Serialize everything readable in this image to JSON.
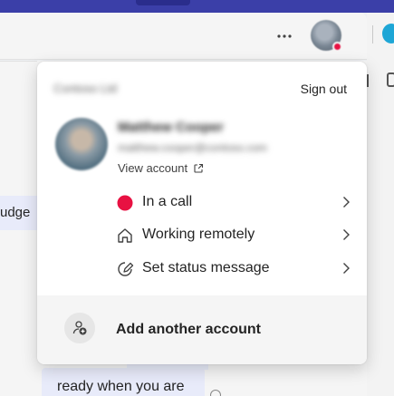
{
  "header": {
    "more_icon": "ellipsis-icon",
    "avatar_status_color": "#e81142"
  },
  "chat": {
    "partial_message": "udge",
    "message": "ready when you are"
  },
  "account_menu": {
    "org_name": "Contoso Ltd",
    "sign_out_label": "Sign out",
    "user_name": "Matthew Cooper",
    "user_email": "matthew.cooper@contoso.com",
    "view_account_label": "View account",
    "items": [
      {
        "label": "In a call",
        "icon": "status-busy-dot-icon",
        "color": "#e81142"
      },
      {
        "label": "Working remotely",
        "icon": "home-icon"
      },
      {
        "label": "Set status message",
        "icon": "edit-status-icon"
      }
    ],
    "add_account_label": "Add another account"
  },
  "colors": {
    "accent_band": "#3b3fa8",
    "busy": "#e81142",
    "bubble": "#e8ebfa"
  }
}
